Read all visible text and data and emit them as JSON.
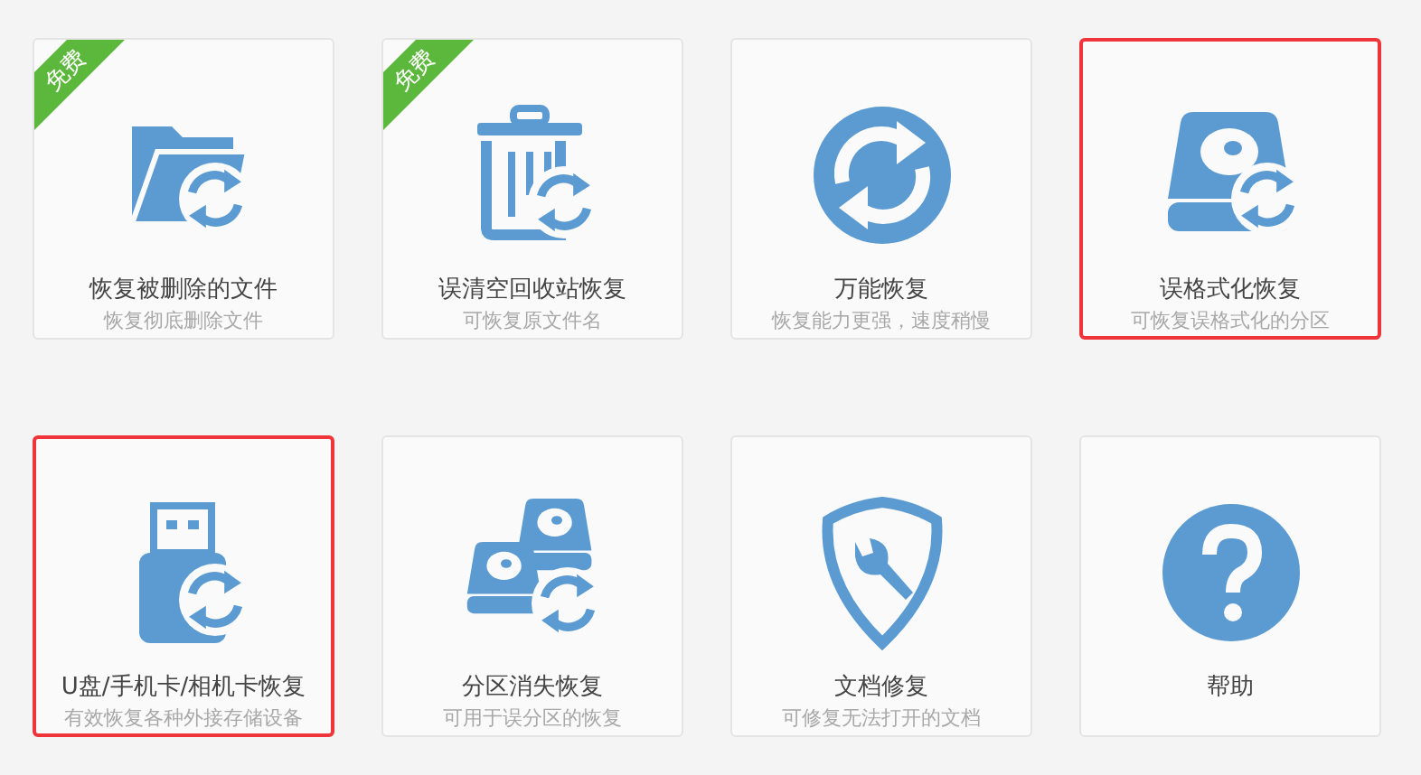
{
  "cards": [
    {
      "kind": "folder",
      "title": "恢复被删除的文件",
      "subtitle": "恢复彻底删除文件",
      "badge": "免费",
      "highlighted": false
    },
    {
      "kind": "trash",
      "title": "误清空回收站恢复",
      "subtitle": "可恢复原文件名",
      "badge": "免费",
      "highlighted": false
    },
    {
      "kind": "sync",
      "title": "万能恢复",
      "subtitle": "恢复能力更强，速度稍慢",
      "highlighted": false
    },
    {
      "kind": "disk",
      "title": "误格式化恢复",
      "subtitle": "可恢复误格式化的分区",
      "highlighted": true
    },
    {
      "kind": "usb",
      "title": "U盘/手机卡/相机卡恢复",
      "subtitle": "有效恢复各种外接存储设备",
      "highlighted": true
    },
    {
      "kind": "disks",
      "title": "分区消失恢复",
      "subtitle": "可用于误分区的恢复",
      "highlighted": false
    },
    {
      "kind": "shield",
      "title": "文档修复",
      "subtitle": "可修复无法打开的文档",
      "highlighted": false
    },
    {
      "kind": "help",
      "title": "帮助",
      "highlighted": false
    }
  ]
}
